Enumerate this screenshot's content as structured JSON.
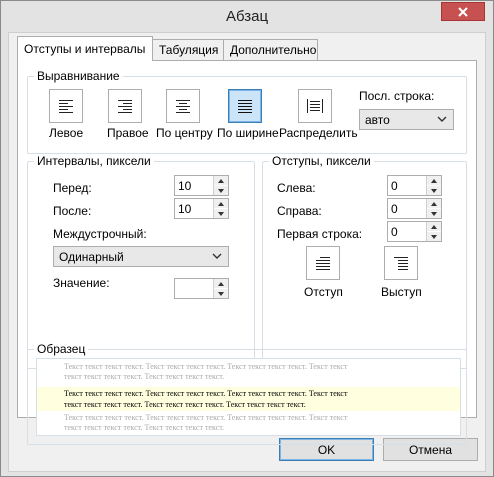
{
  "window": {
    "title": "Абзац"
  },
  "tabs": [
    {
      "label": "Отступы и интервалы",
      "active": true
    },
    {
      "label": "Табуляция",
      "active": false
    },
    {
      "label": "Дополнительно",
      "active": false
    }
  ],
  "alignment": {
    "legend": "Выравнивание",
    "buttons": [
      {
        "label": "Левое",
        "icon": "align-left-icon",
        "selected": false
      },
      {
        "label": "Правое",
        "icon": "align-right-icon",
        "selected": false
      },
      {
        "label": "По центру",
        "icon": "align-center-icon",
        "selected": false
      },
      {
        "label": "По ширине",
        "icon": "align-justify-icon",
        "selected": true
      },
      {
        "label": "Распределить",
        "icon": "align-distribute-icon",
        "selected": false
      }
    ],
    "last_line_label": "Посл. строка:",
    "last_line_value": "авто"
  },
  "spacing": {
    "legend": "Интервалы, пиксели",
    "before_label": "Перед:",
    "before_value": "10",
    "after_label": "После:",
    "after_value": "10",
    "line_label": "Междустрочный:",
    "line_value": "Одинарный",
    "value_label": "Значение:",
    "value_value": ""
  },
  "indents": {
    "legend": "Отступы, пиксели",
    "left_label": "Слева:",
    "left_value": "0",
    "right_label": "Справа:",
    "right_value": "0",
    "first_line_label": "Первая строка:",
    "first_line_value": "0",
    "indent_label": "Отступ",
    "outdent_label": "Выступ"
  },
  "preview": {
    "legend": "Образец",
    "prev_lines": [
      "Текст текст текст текст. Текст текст текст текст. Текст текст текст текст. Текст текст",
      "текст текст текст текст. Текст текст текст текст."
    ],
    "cur_lines": [
      "Текст текст текст текст. Текст текст текст текст. Текст текст текст текст. Текст текст",
      "текст текст текст текст. Текст текст текст текст. Текст текст текст текст."
    ],
    "next_lines": [
      "Текст текст текст текст. Текст текст текст текст. Текст текст текст текст. Текст текст",
      "текст текст текст текст. Текст текст текст текст."
    ]
  },
  "buttons": {
    "ok": "OK",
    "cancel": "Отмена"
  },
  "colors": {
    "close": "#c75050",
    "selection": "#cce4f7",
    "preview_highlight": "#ffffe0"
  }
}
